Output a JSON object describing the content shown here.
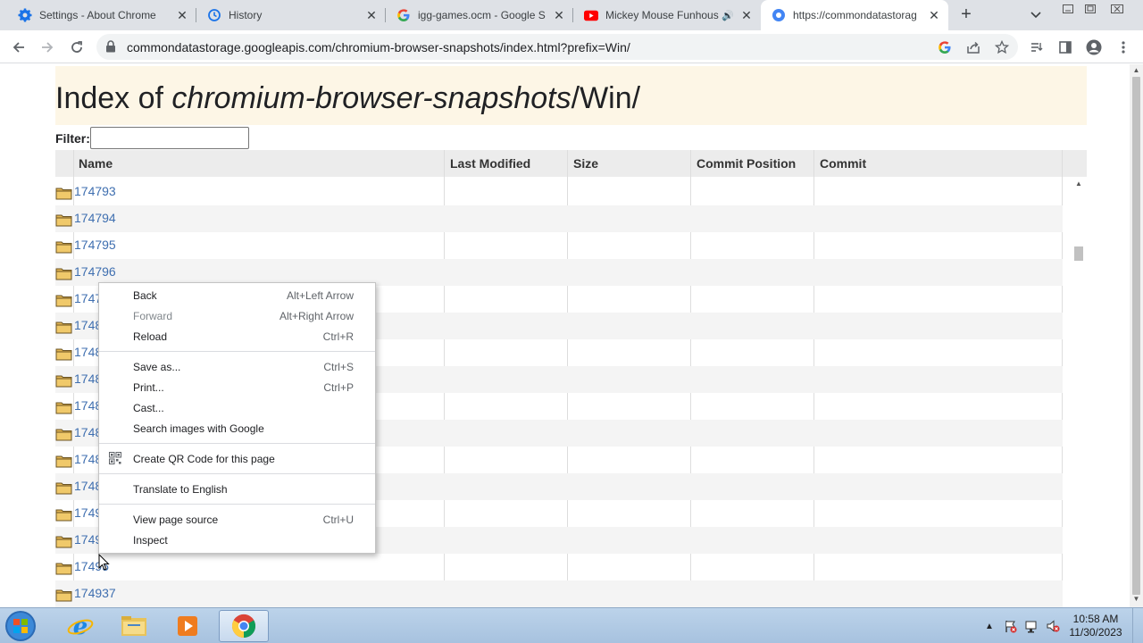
{
  "tabs": [
    {
      "title": "Settings - About Chrome",
      "icon": "gear-icon"
    },
    {
      "title": "History",
      "icon": "history-icon"
    },
    {
      "title": "igg-games.ocm - Google S",
      "icon": "google-icon"
    },
    {
      "title": "Mickey Mouse Funhous",
      "icon": "youtube-icon",
      "audio": "🔊"
    },
    {
      "title": "https://commondatastorag",
      "icon": "site-icon",
      "active": true
    }
  ],
  "toolbar": {
    "url": "commondatastorage.googleapis.com/chromium-browser-snapshots/index.html?prefix=Win/"
  },
  "page": {
    "title_prefix": "Index of ",
    "title_bucket": "chromium-browser-snapshots",
    "title_suffix": "/Win/",
    "filter_label": "Filter:",
    "filter_value": "",
    "columns": [
      "Name",
      "Last Modified",
      "Size",
      "Commit Position",
      "Commit"
    ],
    "rows": [
      "174793",
      "174794",
      "174795",
      "174796",
      "1747",
      "1748",
      "1748",
      "1748",
      "1748",
      "1748",
      "1748",
      "1748",
      "1749",
      "1749",
      "17495",
      "174937"
    ]
  },
  "context_menu": {
    "groups": [
      [
        {
          "label": "Back",
          "shortcut": "Alt+Left Arrow",
          "enabled": true
        },
        {
          "label": "Forward",
          "shortcut": "Alt+Right Arrow",
          "enabled": false
        },
        {
          "label": "Reload",
          "shortcut": "Ctrl+R",
          "enabled": true
        }
      ],
      [
        {
          "label": "Save as...",
          "shortcut": "Ctrl+S",
          "enabled": true
        },
        {
          "label": "Print...",
          "shortcut": "Ctrl+P",
          "enabled": true
        },
        {
          "label": "Cast...",
          "shortcut": "",
          "enabled": true
        },
        {
          "label": "Search images with Google",
          "shortcut": "",
          "enabled": true
        }
      ],
      [
        {
          "label": "Create QR Code for this page",
          "shortcut": "",
          "enabled": true,
          "icon": "qr-code-icon"
        }
      ],
      [
        {
          "label": "Translate to English",
          "shortcut": "",
          "enabled": true
        }
      ],
      [
        {
          "label": "View page source",
          "shortcut": "Ctrl+U",
          "enabled": true
        },
        {
          "label": "Inspect",
          "shortcut": "",
          "enabled": true
        }
      ]
    ]
  },
  "taskbar": {
    "time": "10:58 AM",
    "date": "11/30/2023",
    "apps": [
      "internet-explorer-icon",
      "file-explorer-icon",
      "media-player-icon",
      "chrome-icon"
    ]
  },
  "colors": {
    "link": "#3f6fb0",
    "header_band": "#fdf6e6",
    "tabstrip": "#dee1e6"
  }
}
